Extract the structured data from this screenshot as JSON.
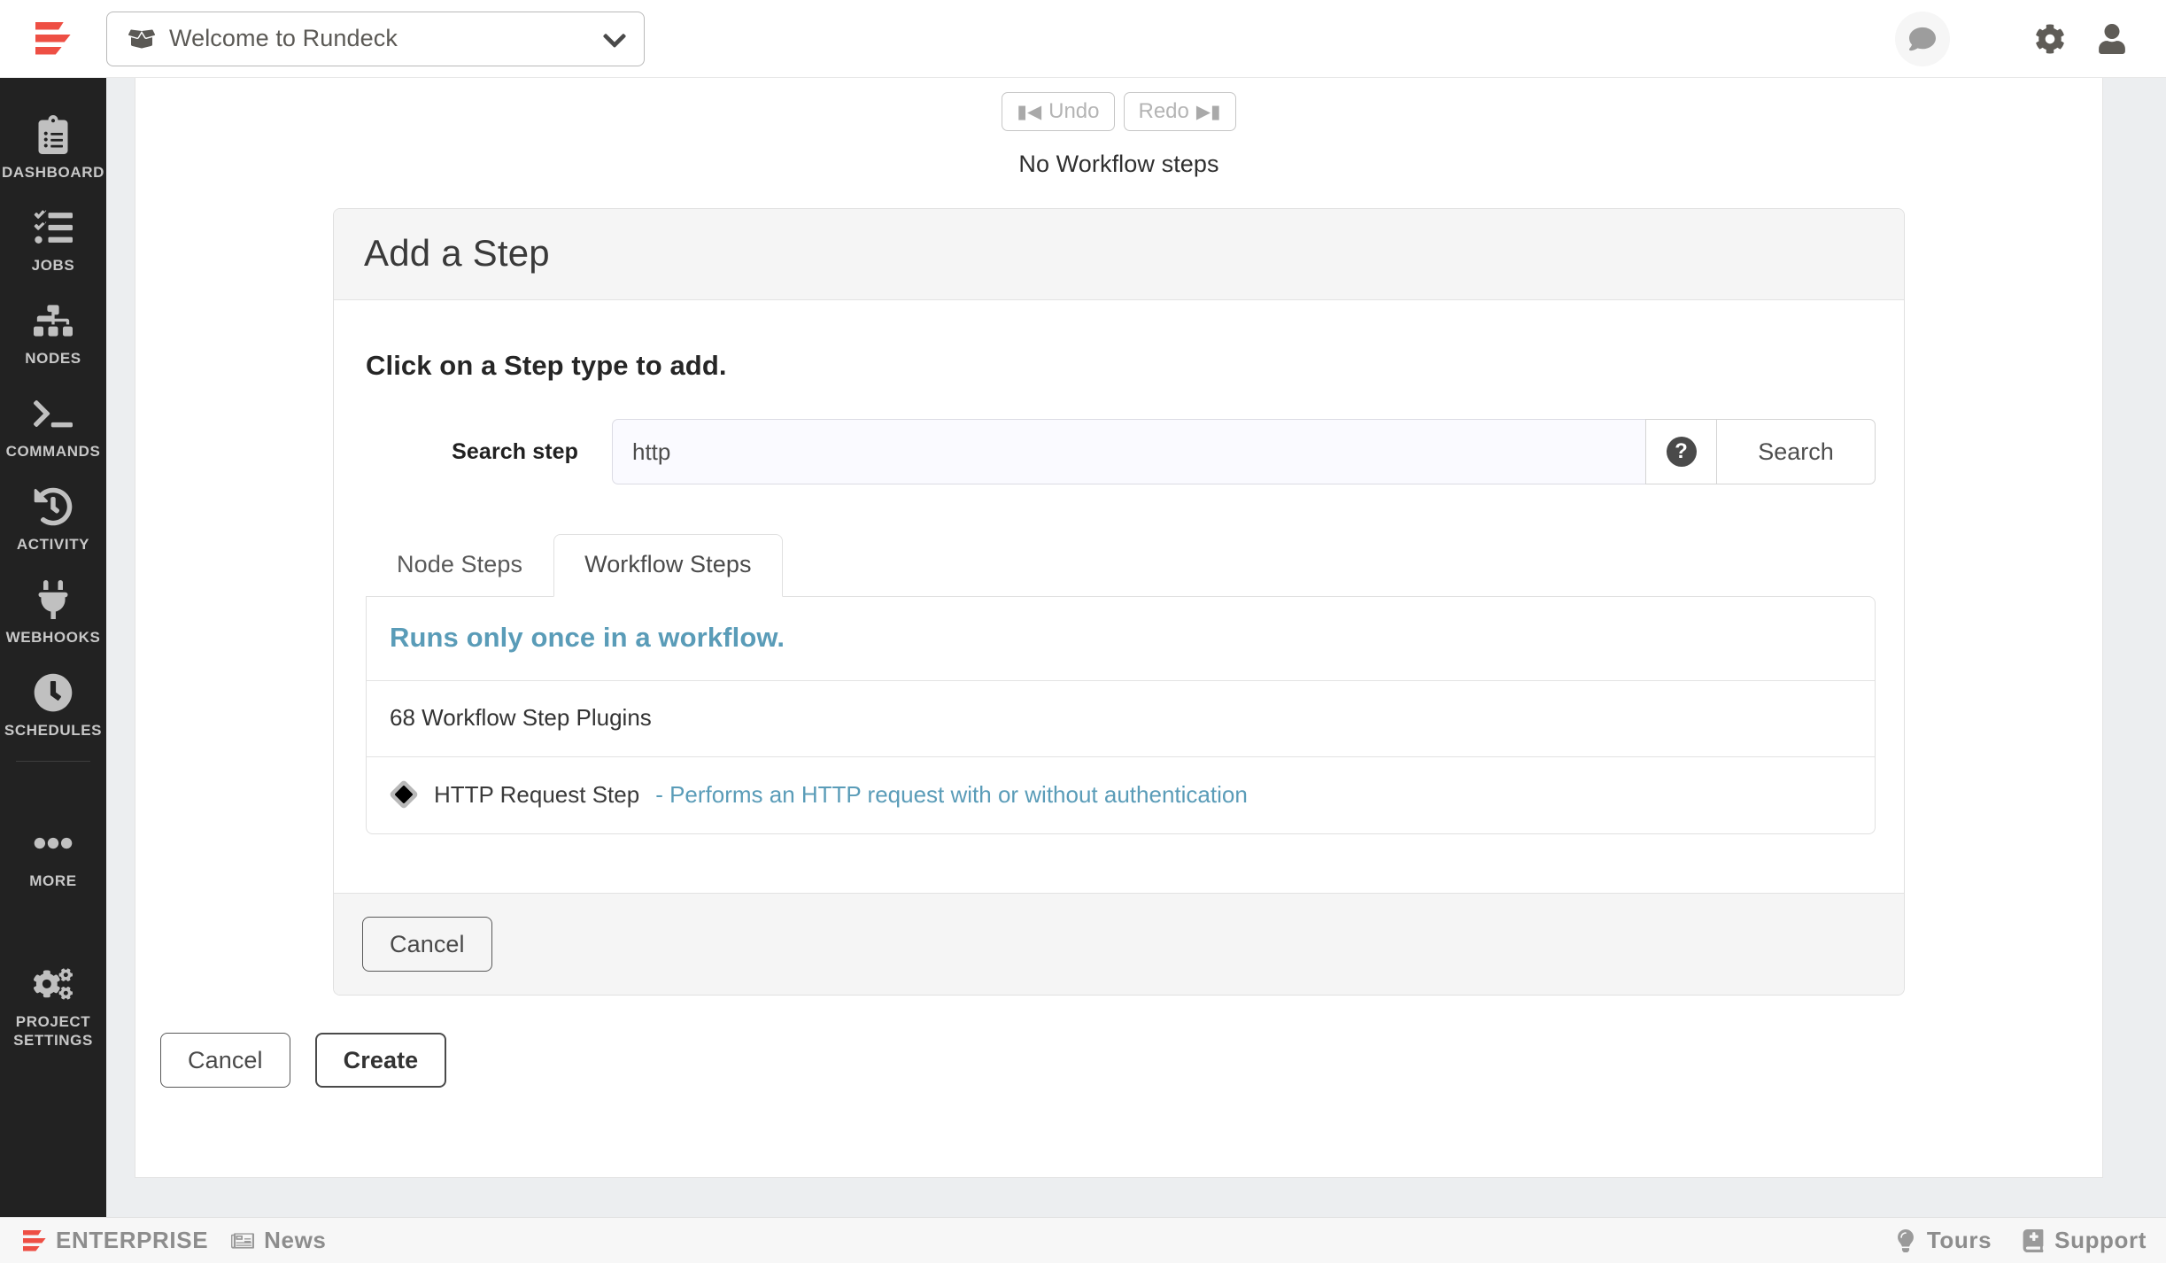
{
  "header": {
    "logo_name": "rundeck-logo",
    "project_selector": {
      "icon": "box-open-icon",
      "label": "Welcome to Rundeck",
      "chevron": "chevron-down-icon"
    },
    "chat_icon": "chat-bubble-icon",
    "settings_icon": "gear-icon",
    "user_icon": "user-avatar-icon"
  },
  "sidebar": {
    "items": [
      {
        "label": "Dashboard",
        "icon": "clipboard-list-icon"
      },
      {
        "label": "Jobs",
        "icon": "checklist-icon"
      },
      {
        "label": "Nodes",
        "icon": "sitemap-icon"
      },
      {
        "label": "Commands",
        "icon": "terminal-icon"
      },
      {
        "label": "Activity",
        "icon": "history-clock-icon"
      },
      {
        "label": "Webhooks",
        "icon": "plug-icon"
      },
      {
        "label": "Schedules",
        "icon": "clock-icon"
      }
    ],
    "more": {
      "label": "More",
      "icon": "ellipsis-icon"
    },
    "project_settings": {
      "label": "Project\nSettings",
      "label_line1": "PROJECT",
      "label_line2": "SETTINGS",
      "icon": "cogs-icon"
    }
  },
  "workflow": {
    "undo_label": "Undo",
    "undo_icon": "step-backward-icon",
    "redo_label": "Redo",
    "redo_icon": "step-forward-icon",
    "empty_text": "No Workflow steps"
  },
  "step_panel": {
    "title": "Add a Step",
    "instruction": "Click on a Step type to add.",
    "search": {
      "label": "Search step",
      "value": "http",
      "placeholder": "",
      "help_icon": "question-circle-icon",
      "button_label": "Search"
    },
    "tabs": [
      {
        "label": "Node Steps",
        "active": false
      },
      {
        "label": "Workflow Steps",
        "active": true
      }
    ],
    "list": {
      "heading": "Runs only once in a workflow.",
      "count_text": "68 Workflow Step Plugins",
      "plugins": [
        {
          "icon": "diamond-icon",
          "name": "HTTP Request Step",
          "description": "- Performs an HTTP request with or without authentication"
        }
      ]
    },
    "cancel_label": "Cancel"
  },
  "bottom_actions": {
    "cancel_label": "Cancel",
    "create_label": "Create"
  },
  "footer": {
    "enterprise_label": "ENTERPRISE",
    "news_label": "News",
    "news_icon": "newspaper-icon",
    "tours_label": "Tours",
    "tours_icon": "lightbulb-icon",
    "support_label": "Support",
    "support_icon": "book-medical-icon"
  },
  "colors": {
    "brand_red": "#ee4f44",
    "sidebar_bg": "#222222",
    "accent_blue": "#5a9cb8",
    "panel_head_bg": "#f5f5f5",
    "page_bg": "#eceef0"
  }
}
